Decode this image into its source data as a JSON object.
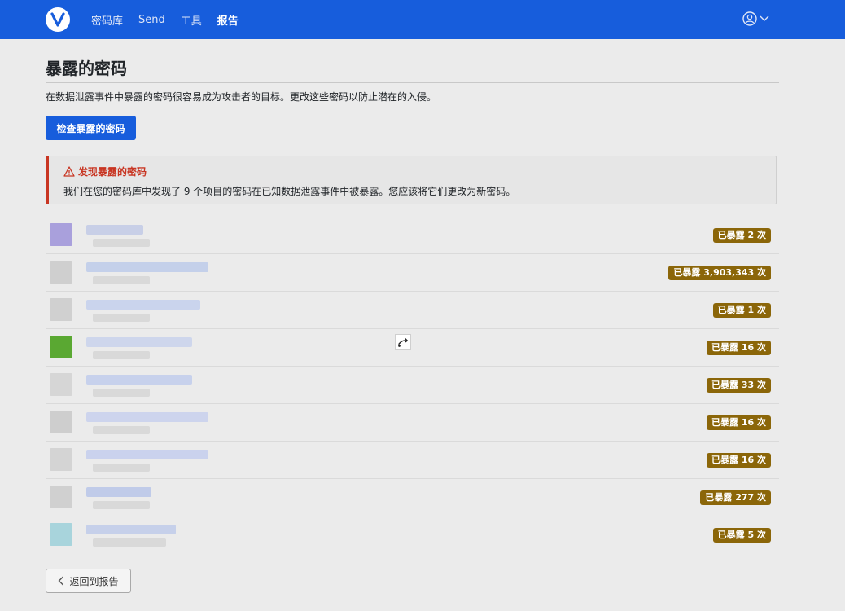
{
  "nav": {
    "logo_icon": "bitwarden-shield-icon",
    "links": [
      {
        "label": "密码库",
        "active": false
      },
      {
        "label": "Send",
        "active": false
      },
      {
        "label": "工具",
        "active": false
      },
      {
        "label": "报告",
        "active": true
      }
    ],
    "account_icon": "user-circle-icon",
    "caret_icon": "caret-down-icon"
  },
  "page": {
    "title": "暴露的密码",
    "description": "在数据泄露事件中暴露的密码很容易成为攻击者的目标。更改这些密码以防止潜在的入侵。",
    "check_button": "检查暴露的密码"
  },
  "alert": {
    "icon": "warning-triangle-icon",
    "title": "发现暴露的密码",
    "message": "我们在您的密码库中发现了 9 个项目的密码在已知数据泄露事件中被暴露。您应该将它们更改为新密码。"
  },
  "items": [
    {
      "badge": "已暴露 2 次",
      "thumb_color": "#a9a0dc",
      "name_color": "#b9c3e6"
    },
    {
      "badge": "已暴露 3,903,343 次",
      "thumb_color": "#cfcfcf",
      "name_color": "#b4c4ea"
    },
    {
      "badge": "已暴露 1 次",
      "thumb_color": "#d0d0d0",
      "name_color": "#bccbee"
    },
    {
      "badge": "已暴露 16 次",
      "thumb_color": "#5aa832",
      "name_color": "#c2cdec"
    },
    {
      "badge": "已暴露 33 次",
      "thumb_color": "#d6d6d6",
      "name_color": "#b8c6ec"
    },
    {
      "badge": "已暴露 16 次",
      "thumb_color": "#cecece",
      "name_color": "#c0cbee"
    },
    {
      "badge": "已暴露 16 次",
      "thumb_color": "#d4d4d4",
      "name_color": "#bcc8ee"
    },
    {
      "badge": "已暴露 277 次",
      "thumb_color": "#d0d0d0",
      "name_color": "#aebde8"
    },
    {
      "badge": "已暴露 5 次",
      "thumb_color": "#a8d4dc",
      "name_color": "#b7c4ea"
    }
  ],
  "back_button": {
    "label": "返回到报告",
    "icon": "chevron-left-icon"
  },
  "colors": {
    "primary": "#175ddc",
    "danger": "#c83522",
    "warning_badge": "#8b6609"
  }
}
